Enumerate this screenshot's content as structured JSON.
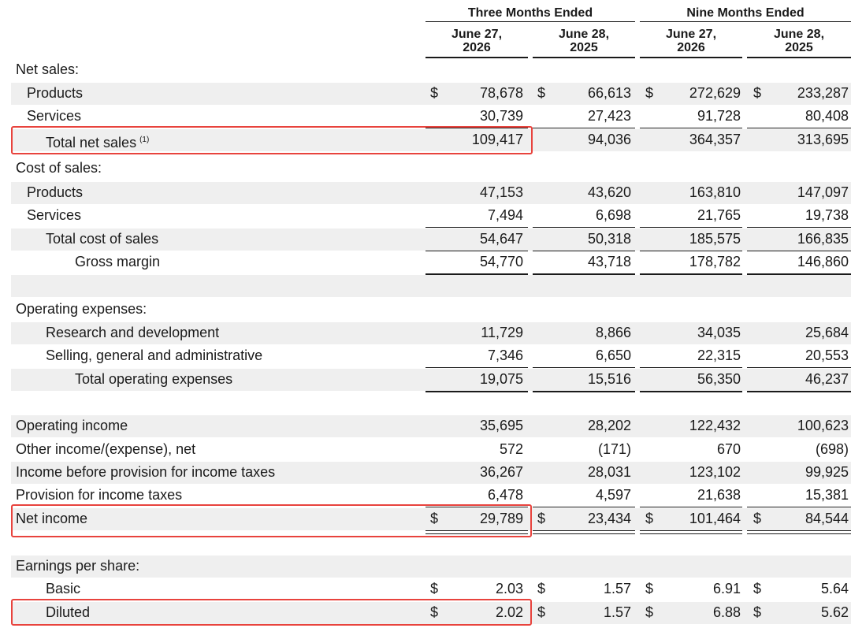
{
  "header": {
    "group_three": "Three Months Ended",
    "group_nine": "Nine Months Ended",
    "columns": [
      {
        "line1": "June 27,",
        "line2": "2026"
      },
      {
        "line1": "June 28,",
        "line2": "2025"
      },
      {
        "line1": "June 27,",
        "line2": "2026"
      },
      {
        "line1": "June 28,",
        "line2": "2025"
      }
    ]
  },
  "rows": [
    {
      "label": "Net sales:",
      "indent": 0,
      "type": "section"
    },
    {
      "label": "Products",
      "indent": 1,
      "dollar": true,
      "values": [
        "78,678",
        "66,613",
        "272,629",
        "233,287"
      ]
    },
    {
      "label": "Services",
      "indent": 1,
      "values": [
        "30,739",
        "27,423",
        "91,728",
        "80,408"
      ]
    },
    {
      "label": "Total net sales",
      "note": "(1)",
      "indent": 2,
      "values": [
        "109,417",
        "94,036",
        "364,357",
        "313,695"
      ]
    },
    {
      "label": "Cost of sales:",
      "indent": 0,
      "type": "section"
    },
    {
      "label": "Products",
      "indent": 1,
      "values": [
        "47,153",
        "43,620",
        "163,810",
        "147,097"
      ]
    },
    {
      "label": "Services",
      "indent": 1,
      "values": [
        "7,494",
        "6,698",
        "21,765",
        "19,738"
      ]
    },
    {
      "label": "Total cost of sales",
      "indent": 2,
      "values": [
        "54,647",
        "50,318",
        "185,575",
        "166,835"
      ]
    },
    {
      "label": "Gross margin",
      "indent": 3,
      "values": [
        "54,770",
        "43,718",
        "178,782",
        "146,860"
      ]
    },
    {
      "label": "",
      "indent": 0,
      "type": "blank"
    },
    {
      "label": "Operating expenses:",
      "indent": 0,
      "type": "section"
    },
    {
      "label": "Research and development",
      "indent": 2,
      "values": [
        "11,729",
        "8,866",
        "34,035",
        "25,684"
      ]
    },
    {
      "label": "Selling, general and administrative",
      "indent": 2,
      "values": [
        "7,346",
        "6,650",
        "22,315",
        "20,553"
      ]
    },
    {
      "label": "Total operating expenses",
      "indent": 3,
      "values": [
        "19,075",
        "15,516",
        "56,350",
        "46,237"
      ]
    },
    {
      "label": "",
      "indent": 0,
      "type": "blank"
    },
    {
      "label": "Operating income",
      "indent": 0,
      "values": [
        "35,695",
        "28,202",
        "122,432",
        "100,623"
      ]
    },
    {
      "label": "Other income/(expense), net",
      "indent": 0,
      "values": [
        "572",
        "(171)",
        "670",
        "(698)"
      ]
    },
    {
      "label": "Income before provision for income taxes",
      "indent": 0,
      "values": [
        "36,267",
        "28,031",
        "123,102",
        "99,925"
      ]
    },
    {
      "label": "Provision for income taxes",
      "indent": 0,
      "values": [
        "6,478",
        "4,597",
        "21,638",
        "15,381"
      ]
    },
    {
      "label": "Net income",
      "indent": 0,
      "dollar": true,
      "values": [
        "29,789",
        "23,434",
        "101,464",
        "84,544"
      ]
    },
    {
      "label": "",
      "indent": 0,
      "type": "blank"
    },
    {
      "label": "Earnings per share:",
      "indent": 0,
      "type": "section"
    },
    {
      "label": "Basic",
      "indent": 2,
      "dollar": true,
      "values": [
        "2.03",
        "1.57",
        "6.91",
        "5.64"
      ]
    },
    {
      "label": "Diluted",
      "indent": 2,
      "dollar": true,
      "values": [
        "2.02",
        "1.57",
        "6.88",
        "5.62"
      ]
    }
  ],
  "currency_symbol": "$",
  "highlight_color": "#e8433d"
}
